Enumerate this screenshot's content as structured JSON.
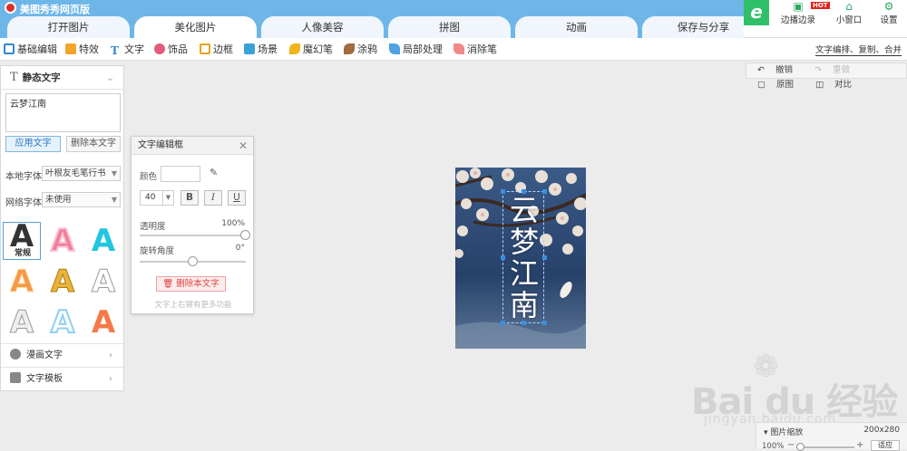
{
  "app": {
    "title": "美图秀秀网页版"
  },
  "tabs": [
    "打开图片",
    "美化图片",
    "人像美容",
    "拼图",
    "动画",
    "保存与分享"
  ],
  "window_buttons": [
    {
      "label": "边播边录",
      "icon": "record-icon",
      "badge": "HOT"
    },
    {
      "label": "小窗口",
      "icon": "mini-window-icon"
    },
    {
      "label": "设置",
      "icon": "gear-icon"
    }
  ],
  "toolbar": {
    "items": [
      {
        "label": "基础编辑",
        "icon": "basic-edit-icon",
        "color": "#2f87d3"
      },
      {
        "label": "特效",
        "icon": "effects-icon",
        "color": "#f1a629"
      },
      {
        "label": "文字",
        "icon": "text-icon",
        "color": "#2f87d3"
      },
      {
        "label": "饰品",
        "icon": "accessory-icon",
        "color": "#e15b7a"
      },
      {
        "label": "边框",
        "icon": "frame-icon",
        "color": "#e9a21f"
      },
      {
        "label": "场景",
        "icon": "scene-icon",
        "color": "#3aa2d8"
      },
      {
        "label": "魔幻笔",
        "icon": "magic-pen-icon",
        "color": "#f0b41c"
      },
      {
        "label": "涂鸦",
        "icon": "doodle-icon",
        "color": "#a06b40"
      },
      {
        "label": "局部处理",
        "icon": "local-process-icon",
        "color": "#4fa3e0"
      },
      {
        "label": "消除笔",
        "icon": "eraser-pen-icon",
        "color": "#f08a8a"
      }
    ],
    "right_link": "文字编排、复制、合并"
  },
  "history": {
    "undo": "撤销",
    "redo": "重做",
    "original": "原图",
    "compare": "对比"
  },
  "left_panel": {
    "header": "静态文字",
    "text_value": "云梦江南",
    "apply_btn": "应用文字",
    "delete_btn": "删除本文字",
    "local_font_label": "本地字体",
    "local_font_value": "叶根友毛笔行书",
    "web_font_label": "网络字体",
    "web_font_value": "未使用",
    "styles": [
      {
        "glyph": "A",
        "sub": "常规",
        "color": "#333333"
      },
      {
        "glyph": "A",
        "color": "#f27d9b"
      },
      {
        "glyph": "A",
        "color": "#22c6e0"
      },
      {
        "glyph": "A",
        "color": "#f29a4a"
      },
      {
        "glyph": "A",
        "color": "#e7b33a"
      },
      {
        "glyph": "A",
        "color": "#ffffff"
      },
      {
        "glyph": "A",
        "color": "#e6e6e6"
      },
      {
        "glyph": "A",
        "color": "#a8d8f0"
      },
      {
        "glyph": "A",
        "color": "#f47a4a"
      }
    ],
    "comic_text": "漫画文字",
    "text_template": "文字模板"
  },
  "dialog": {
    "title": "文字编辑框",
    "color_label": "颜色",
    "font_size": "40",
    "bold": "B",
    "italic": "I",
    "underline": "U",
    "opacity_label": "透明度",
    "opacity_value": "100%",
    "opacity_level": 1.0,
    "rotation_label": "旋转角度",
    "rotation_value": "0°",
    "rotation_level": 0.5,
    "delete_btn": "删除本文字",
    "hint": "文字上右键有更多功能"
  },
  "canvas": {
    "text": "云梦江南"
  },
  "zoom": {
    "title": "图片缩放",
    "size": "200x280",
    "percent": "100%",
    "fit": "适应"
  },
  "watermark": {
    "main": "Bai du 经验",
    "sub": "jingyan.baidu.com"
  }
}
